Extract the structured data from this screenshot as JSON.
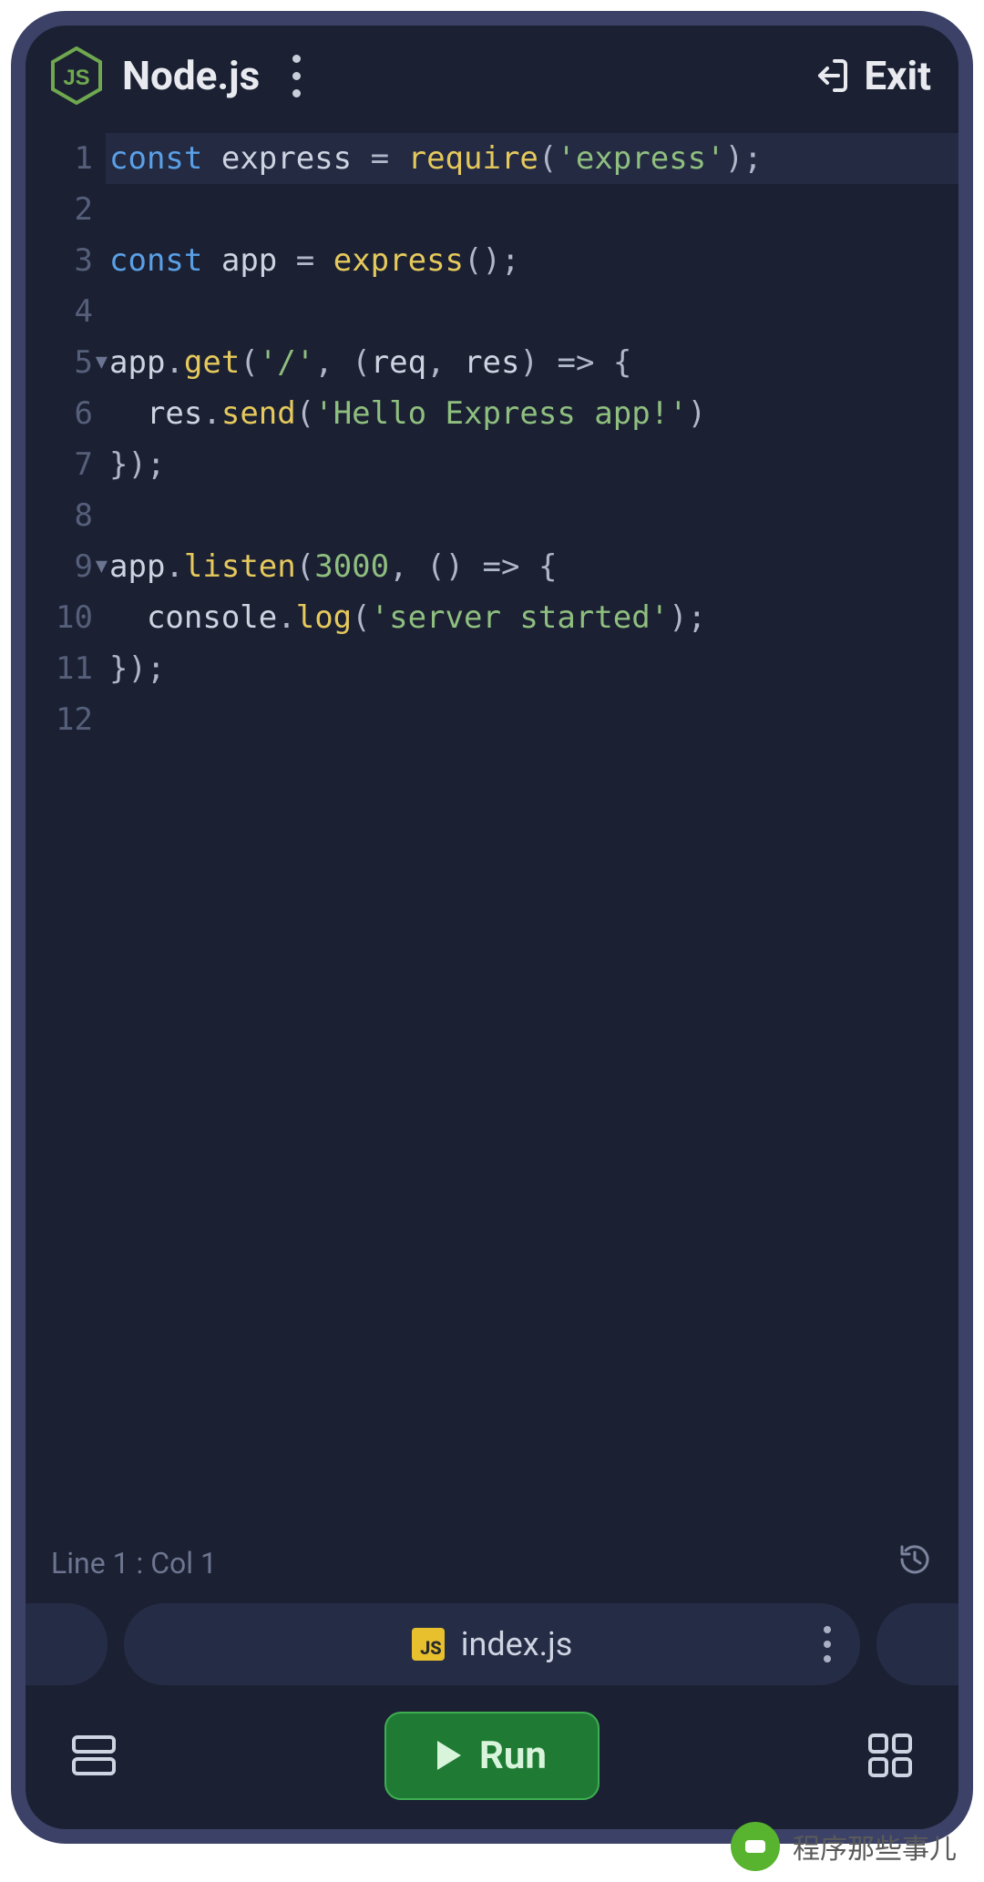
{
  "header": {
    "title": "Node.js",
    "exit_label": "Exit"
  },
  "editor": {
    "lines": [
      {
        "n": 1,
        "fold": false,
        "hl": true,
        "tokens": [
          [
            "kw",
            "const"
          ],
          [
            "sp",
            " "
          ],
          [
            "id",
            "express"
          ],
          [
            "sp",
            " "
          ],
          [
            "op",
            "="
          ],
          [
            "sp",
            " "
          ],
          [
            "fn",
            "require"
          ],
          [
            "pn",
            "("
          ],
          [
            "str",
            "'express'"
          ],
          [
            "pn",
            ")"
          ],
          [
            "pn",
            ";"
          ]
        ]
      },
      {
        "n": 2,
        "fold": false,
        "hl": false,
        "tokens": []
      },
      {
        "n": 3,
        "fold": false,
        "hl": false,
        "tokens": [
          [
            "kw",
            "const"
          ],
          [
            "sp",
            " "
          ],
          [
            "id",
            "app"
          ],
          [
            "sp",
            " "
          ],
          [
            "op",
            "="
          ],
          [
            "sp",
            " "
          ],
          [
            "fn",
            "express"
          ],
          [
            "pn",
            "("
          ],
          [
            "pn",
            ")"
          ],
          [
            "pn",
            ";"
          ]
        ]
      },
      {
        "n": 4,
        "fold": false,
        "hl": false,
        "tokens": []
      },
      {
        "n": 5,
        "fold": true,
        "hl": false,
        "tokens": [
          [
            "id",
            "app"
          ],
          [
            "pn",
            "."
          ],
          [
            "fn",
            "get"
          ],
          [
            "pn",
            "("
          ],
          [
            "str",
            "'/'"
          ],
          [
            "pn",
            ","
          ],
          [
            "sp",
            " "
          ],
          [
            "pn",
            "("
          ],
          [
            "id",
            "req"
          ],
          [
            "pn",
            ","
          ],
          [
            "sp",
            " "
          ],
          [
            "id",
            "res"
          ],
          [
            "pn",
            ")"
          ],
          [
            "sp",
            " "
          ],
          [
            "op",
            "=>"
          ],
          [
            "sp",
            " "
          ],
          [
            "pn",
            "{"
          ]
        ]
      },
      {
        "n": 6,
        "fold": false,
        "hl": false,
        "tokens": [
          [
            "sp",
            "  "
          ],
          [
            "id",
            "res"
          ],
          [
            "pn",
            "."
          ],
          [
            "fn",
            "send"
          ],
          [
            "pn",
            "("
          ],
          [
            "str",
            "'Hello Express app!'"
          ],
          [
            "pn",
            ")"
          ]
        ]
      },
      {
        "n": 7,
        "fold": false,
        "hl": false,
        "tokens": [
          [
            "pn",
            "}"
          ],
          [
            "pn",
            ")"
          ],
          [
            "pn",
            ";"
          ]
        ]
      },
      {
        "n": 8,
        "fold": false,
        "hl": false,
        "tokens": []
      },
      {
        "n": 9,
        "fold": true,
        "hl": false,
        "tokens": [
          [
            "id",
            "app"
          ],
          [
            "pn",
            "."
          ],
          [
            "fn",
            "listen"
          ],
          [
            "pn",
            "("
          ],
          [
            "num",
            "3000"
          ],
          [
            "pn",
            ","
          ],
          [
            "sp",
            " "
          ],
          [
            "pn",
            "("
          ],
          [
            "pn",
            ")"
          ],
          [
            "sp",
            " "
          ],
          [
            "op",
            "=>"
          ],
          [
            "sp",
            " "
          ],
          [
            "pn",
            "{"
          ]
        ]
      },
      {
        "n": 10,
        "fold": false,
        "hl": false,
        "tokens": [
          [
            "sp",
            "  "
          ],
          [
            "id",
            "console"
          ],
          [
            "pn",
            "."
          ],
          [
            "fn",
            "log"
          ],
          [
            "pn",
            "("
          ],
          [
            "str",
            "'server started'"
          ],
          [
            "pn",
            ")"
          ],
          [
            "pn",
            ";"
          ]
        ]
      },
      {
        "n": 11,
        "fold": false,
        "hl": false,
        "tokens": [
          [
            "pn",
            "}"
          ],
          [
            "pn",
            ")"
          ],
          [
            "pn",
            ";"
          ]
        ]
      },
      {
        "n": 12,
        "fold": false,
        "hl": false,
        "tokens": []
      }
    ]
  },
  "status": {
    "cursor_label": "Line 1 : Col 1"
  },
  "tabs": {
    "active_filename": "index.js",
    "badge_text": "JS"
  },
  "actions": {
    "run_label": "Run"
  },
  "watermark": {
    "text": "程序那些事儿"
  },
  "colors": {
    "bg": "#1b2133",
    "frame": "#3c4267",
    "accent_green": "#1f7a33"
  }
}
